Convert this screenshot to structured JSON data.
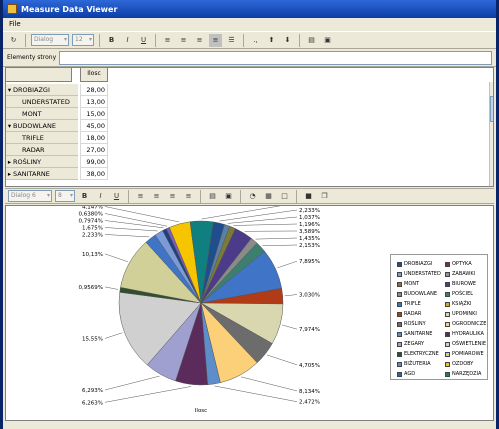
{
  "window": {
    "title": "Measure Data Viewer"
  },
  "menu": {
    "file": "File"
  },
  "toolbar": {
    "font": "Dialog",
    "size": "12",
    "bold": "B",
    "italic": "I",
    "underline": "U"
  },
  "filter": {
    "label": "Elementy strony",
    "value": ""
  },
  "grid": {
    "column_header": "Ilosc",
    "rows": [
      {
        "label": "DROBIAZGI",
        "value": "28,00",
        "expander": "▾",
        "indent": 0
      },
      {
        "label": "UNDERSTATED",
        "value": "13,00",
        "expander": "",
        "indent": 1
      },
      {
        "label": "MONT",
        "value": "15,00",
        "expander": "",
        "indent": 1
      },
      {
        "label": "BUDOWLANE",
        "value": "45,00",
        "expander": "▾",
        "indent": 0
      },
      {
        "label": "TRIFLE",
        "value": "18,00",
        "expander": "",
        "indent": 1
      },
      {
        "label": "RADAR",
        "value": "27,00",
        "expander": "",
        "indent": 1
      },
      {
        "label": "ROŚLINY",
        "value": "99,00",
        "expander": "▸",
        "indent": 0
      },
      {
        "label": "SANITARNE",
        "value": "38,00",
        "expander": "▸",
        "indent": 0
      }
    ]
  },
  "chart_toolbar": {
    "font": "Dialog 6",
    "size": "8",
    "bold": "B",
    "italic": "I",
    "underline": "U"
  },
  "chart_data": {
    "type": "pie",
    "xlabel": "Ilosc",
    "slices": [
      {
        "label": "2,233%",
        "value": 2.233,
        "color": "#1f4e8c"
      },
      {
        "label": "1,037%",
        "value": 1.037,
        "color": "#5a7fa8"
      },
      {
        "label": "1,196%",
        "value": 1.196,
        "color": "#7b7b39"
      },
      {
        "label": "3,589%",
        "value": 3.589,
        "color": "#4b3b88"
      },
      {
        "label": "1,435%",
        "value": 1.435,
        "color": "#8a8a8a"
      },
      {
        "label": "2,153%",
        "value": 2.153,
        "color": "#3c7f6f"
      },
      {
        "label": "7,895%",
        "value": 7.895,
        "color": "#3f74c7"
      },
      {
        "label": "3,030%",
        "value": 3.03,
        "color": "#b13a17"
      },
      {
        "label": "7,974%",
        "value": 7.974,
        "color": "#d9d7b0"
      },
      {
        "label": "4,705%",
        "value": 4.705,
        "color": "#6c6c6c"
      },
      {
        "label": "8,134%",
        "value": 8.134,
        "color": "#fcd079"
      },
      {
        "label": "2,472%",
        "value": 2.472,
        "color": "#5e8ec9"
      },
      {
        "label": "6,263%",
        "value": 6.263,
        "color": "#5b2c5b"
      },
      {
        "label": "6,293%",
        "value": 6.293,
        "color": "#a0a0d0"
      },
      {
        "label": "15,55%",
        "value": 15.55,
        "color": "#d0d0d0"
      },
      {
        "label": "0,9569%",
        "value": 0.9569,
        "color": "#2f4f2f"
      },
      {
        "label": "10,13%",
        "value": 10.13,
        "color": "#d0d098"
      },
      {
        "label": "2,233%",
        "value": 2.233,
        "color": "#3f74c7"
      },
      {
        "label": "1,675%",
        "value": 1.675,
        "color": "#7a9ad8"
      },
      {
        "label": "0,7974%",
        "value": 0.7974,
        "color": "#1f3f7f"
      },
      {
        "label": "0,6380%",
        "value": 0.638,
        "color": "#7c5cbf"
      },
      {
        "label": "4,147%",
        "value": 4.147,
        "color": "#f7c400"
      },
      {
        "label": "4,466%",
        "value": 4.466,
        "color": "#0f7f7f"
      }
    ],
    "legend": [
      {
        "label": "DROBIAZGI",
        "color": "#1f4e8c"
      },
      {
        "label": "OPTYKA",
        "color": "#7b2c5b"
      },
      {
        "label": "UNDERSTATED",
        "color": "#7a9ad8"
      },
      {
        "label": "ZABAWKI",
        "color": "#9090a8"
      },
      {
        "label": "MONT",
        "color": "#7b7b39"
      },
      {
        "label": "BIUROWE",
        "color": "#4b3b88"
      },
      {
        "label": "BUDOWLANE",
        "color": "#8a8a8a"
      },
      {
        "label": "POŚCIEL",
        "color": "#3c7f6f"
      },
      {
        "label": "TRIFLE",
        "color": "#3f74c7"
      },
      {
        "label": "KSIĄŻKI",
        "color": "#e8a020"
      },
      {
        "label": "RADAR",
        "color": "#b13a17"
      },
      {
        "label": "UPOMINKI",
        "color": "#d9d7b0"
      },
      {
        "label": "ROŚLINY",
        "color": "#6c6c6c"
      },
      {
        "label": "OGRODNICZE",
        "color": "#fcd079"
      },
      {
        "label": "SANITARNE",
        "color": "#5e8ec9"
      },
      {
        "label": "HYDRAULIKA",
        "color": "#5b2c5b"
      },
      {
        "label": "ZEGARY",
        "color": "#a0a0d0"
      },
      {
        "label": "OŚWIETLENIE",
        "color": "#d0d0d0"
      },
      {
        "label": "ELEKTRYCZNE",
        "color": "#2f4f2f"
      },
      {
        "label": "POMIAROWE",
        "color": "#d0d098"
      },
      {
        "label": "BIŻUTERIA",
        "color": "#5b8bd8"
      },
      {
        "label": "OZDOBY",
        "color": "#f7c400"
      },
      {
        "label": "AGD",
        "color": "#2f5fbf"
      },
      {
        "label": "NARZĘDZIA",
        "color": "#0f7f7f"
      }
    ]
  }
}
